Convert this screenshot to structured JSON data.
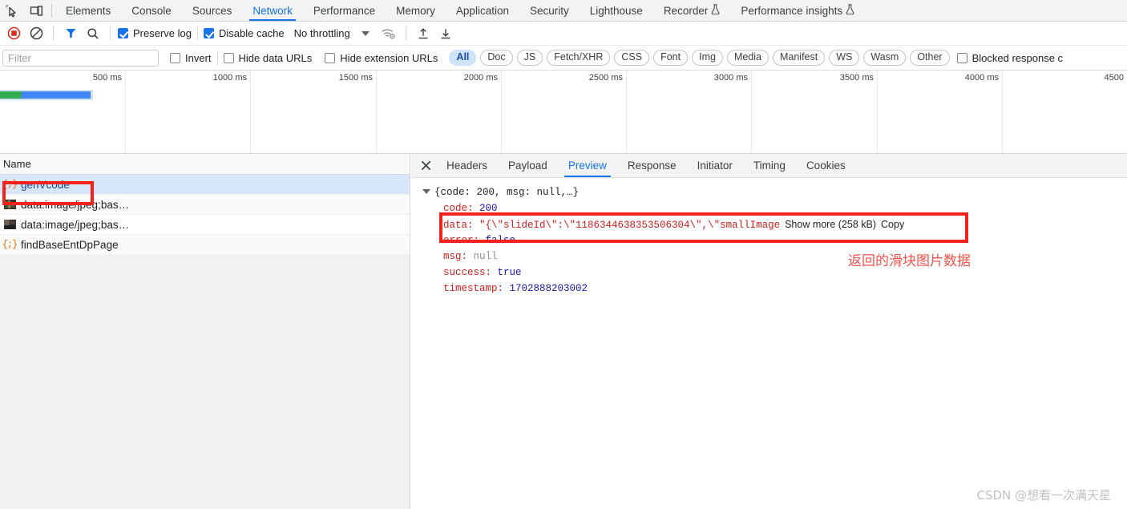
{
  "devtools": {
    "main_tabs": [
      {
        "label": "Elements",
        "active": false,
        "flask": false
      },
      {
        "label": "Console",
        "active": false,
        "flask": false
      },
      {
        "label": "Sources",
        "active": false,
        "flask": false
      },
      {
        "label": "Network",
        "active": true,
        "flask": false
      },
      {
        "label": "Performance",
        "active": false,
        "flask": false
      },
      {
        "label": "Memory",
        "active": false,
        "flask": false
      },
      {
        "label": "Application",
        "active": false,
        "flask": false
      },
      {
        "label": "Security",
        "active": false,
        "flask": false
      },
      {
        "label": "Lighthouse",
        "active": false,
        "flask": false
      },
      {
        "label": "Recorder",
        "active": false,
        "flask": true
      },
      {
        "label": "Performance insights",
        "active": false,
        "flask": true
      }
    ],
    "left_icons": [
      {
        "name": "inspect-element-icon"
      },
      {
        "name": "device-toolbar-icon"
      }
    ]
  },
  "controls": {
    "record_button": "record-stop-icon",
    "clear_button": "clear-icon",
    "filter_button": "filter-funnel-icon",
    "search_button": "search-icon",
    "preserve_log": {
      "label": "Preserve log",
      "checked": true
    },
    "disable_cache": {
      "label": "Disable cache",
      "checked": true
    },
    "throttling": {
      "value": "No throttling"
    },
    "network_conditions_icon": "wifi-settings-icon",
    "import_har_icon": "upload-arrow-icon",
    "export_har_icon": "download-arrow-icon"
  },
  "filters": {
    "filter_placeholder": "Filter",
    "filter_value": "",
    "invert": {
      "label": "Invert",
      "checked": false
    },
    "hide_data_urls": {
      "label": "Hide data URLs",
      "checked": false
    },
    "hide_extension_urls": {
      "label": "Hide extension URLs",
      "checked": false
    },
    "types": [
      {
        "label": "All",
        "selected": true
      },
      {
        "label": "Doc",
        "selected": false
      },
      {
        "label": "JS",
        "selected": false
      },
      {
        "label": "Fetch/XHR",
        "selected": false
      },
      {
        "label": "CSS",
        "selected": false
      },
      {
        "label": "Font",
        "selected": false
      },
      {
        "label": "Img",
        "selected": false
      },
      {
        "label": "Media",
        "selected": false
      },
      {
        "label": "Manifest",
        "selected": false
      },
      {
        "label": "WS",
        "selected": false
      },
      {
        "label": "Wasm",
        "selected": false
      },
      {
        "label": "Other",
        "selected": false
      }
    ],
    "blocked_responses": {
      "label": "Blocked response c",
      "checked": false
    }
  },
  "overview": {
    "ticks": [
      "500 ms",
      "1000 ms",
      "1500 ms",
      "2000 ms",
      "2500 ms",
      "3000 ms",
      "3500 ms",
      "4000 ms",
      "4500"
    ],
    "bar_colors": {
      "waiting": "#32ab53",
      "download": "#4285f4",
      "halo": "#d2e3fc"
    }
  },
  "requests": {
    "column_header": "Name",
    "rows": [
      {
        "name": "genVcode",
        "icon": "json-icon",
        "selected": true
      },
      {
        "name": "data:image/jpeg;bas…",
        "icon": "image-thumbnail-icon",
        "selected": false
      },
      {
        "name": "data:image/jpeg;bas…",
        "icon": "image-thumbnail-icon",
        "selected": false
      },
      {
        "name": "findBaseEntDpPage",
        "icon": "json-icon",
        "selected": false
      }
    ]
  },
  "detail": {
    "close_label": "✕",
    "tabs": [
      {
        "label": "Headers",
        "active": false
      },
      {
        "label": "Payload",
        "active": false
      },
      {
        "label": "Preview",
        "active": true
      },
      {
        "label": "Response",
        "active": false
      },
      {
        "label": "Initiator",
        "active": false
      },
      {
        "label": "Timing",
        "active": false
      },
      {
        "label": "Cookies",
        "active": false
      }
    ],
    "preview": {
      "root_summary": "{code: 200, msg: null,…}",
      "properties": [
        {
          "key": "code",
          "value": "200",
          "type": "num"
        },
        {
          "key": "data",
          "value": "\"{\\\"slideId\\\":\\\"1186344638353506304\\\",\\\"smallImage",
          "type": "str",
          "truncated": true,
          "show_more": "Show more (258 kB)",
          "copy": "Copy"
        },
        {
          "key": "error",
          "value": "false",
          "type": "bool"
        },
        {
          "key": "msg",
          "value": "null",
          "type": "null"
        },
        {
          "key": "success",
          "value": "true",
          "type": "bool"
        },
        {
          "key": "timestamp",
          "value": "1702888203002",
          "type": "num"
        }
      ]
    }
  },
  "annotations": {
    "note_text": "返回的滑块图片数据",
    "highlight_color": "#f5211c"
  },
  "watermark": "CSDN @想看一次满天星"
}
